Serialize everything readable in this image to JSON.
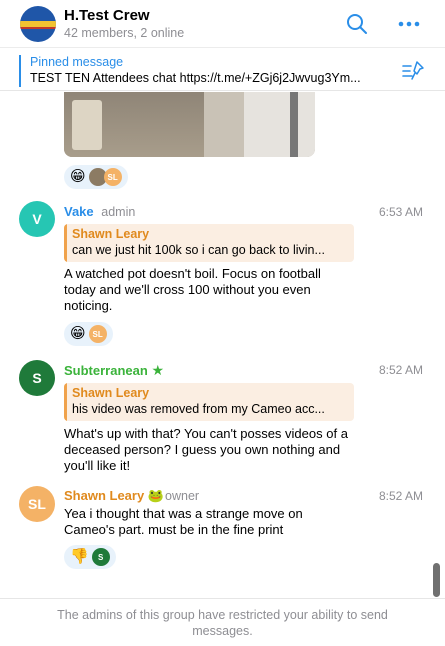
{
  "header": {
    "title": "H.Test Crew",
    "subtitle": "42 members, 2 online",
    "search_icon": "search-icon",
    "more_icon": "more-icon"
  },
  "pinned": {
    "title": "Pinned message",
    "text": "TEST TEN Attendees chat https://t.me/+ZGj6j2Jwvug3Ym...",
    "icon": "pin-list-icon"
  },
  "chat": {
    "top_reactions": [
      {
        "emoji": "😁"
      },
      {
        "avatar_initials": "SL"
      }
    ],
    "messages": [
      {
        "sender": "Vake",
        "role": "admin",
        "avatar_initial": "V",
        "avatar_color": "#26c6b3",
        "sender_color": "#2a8ee8",
        "time": "6:53 AM",
        "reply_name": "Shawn Leary",
        "reply_text": "can we just hit 100k so i can go back to livin...",
        "text": "A watched pot doesn't boil. Focus on football today and we'll cross 100 without you even noticing.",
        "reactions": [
          {
            "emoji": "😁"
          },
          {
            "avatar_initials": "SL"
          }
        ]
      },
      {
        "sender": "Subterranean",
        "badge": "★",
        "avatar_initial": "S",
        "avatar_color": "#1f7a3a",
        "sender_color": "#3bb33b",
        "time": "8:52 AM",
        "reply_name": "Shawn Leary",
        "reply_text": "his video was removed from my Cameo acc...",
        "text": "What's up with that? You can't posses videos of a deceased person? I guess you own nothing and you'll like it!"
      },
      {
        "sender": "Shawn Leary",
        "sender_emoji": "🐸",
        "role": "owner",
        "avatar_initial": "SL",
        "avatar_color": "#f4b266",
        "sender_color": "#e08a1e",
        "time": "8:52 AM",
        "text": "Yea i thought that was a strange move on Cameo's part.  must be in the fine print",
        "reactions": [
          {
            "emoji": "👎"
          },
          {
            "avatar_initials": "S"
          }
        ]
      }
    ]
  },
  "footer": {
    "text": "The admins of this group have restricted your ability to send messages."
  },
  "colors": {
    "accent": "#2a8ee8",
    "reply_bg": "#fbeee2",
    "reply_bar": "#f0a24b",
    "reaction_bg": "#e8f2fb"
  }
}
